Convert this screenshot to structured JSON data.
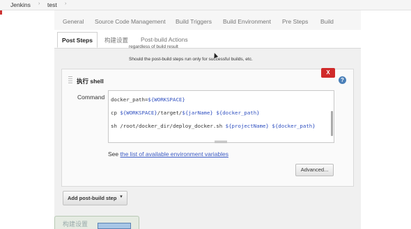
{
  "breadcrumb": {
    "root": "Jenkins",
    "sep": "›",
    "job": "test"
  },
  "tabs_primary": [
    "General",
    "Source Code Management",
    "Build Triggers",
    "Build Environment",
    "Pre Steps",
    "Build"
  ],
  "tabs_secondary": {
    "active": "Post Steps",
    "others": [
      "构建设置",
      "Post-build Actions"
    ]
  },
  "post_steps": {
    "cut_text": "regardless of build result",
    "hint": "Should the post-build steps run only for successful builds, etc."
  },
  "shell_step": {
    "title": "执行 shell",
    "delete_label": "X",
    "help_label": "?",
    "command_label": "Command",
    "command_lines": [
      [
        "docker_path=",
        "${WORKSPACE}"
      ],
      [
        "cp ",
        "${WORKSPACE}",
        "/target/",
        "${jarName}",
        " ",
        "${docker_path}"
      ],
      [
        "sh /root/docker_dir/deploy_docker.sh ",
        "${projectName}",
        " ",
        "${docker_path}"
      ]
    ],
    "see_prefix": "See ",
    "see_link": "the list of available environment variables",
    "advanced_label": "Advanced..."
  },
  "add_post_build_step": {
    "label": "Add post-build step",
    "arrow": "▼"
  },
  "bottom_partial": {
    "label": "构建设置"
  },
  "colors": {
    "delete_red": "#d02a2a",
    "link_blue": "#3a5ac4",
    "var_blue": "#3050c0"
  }
}
